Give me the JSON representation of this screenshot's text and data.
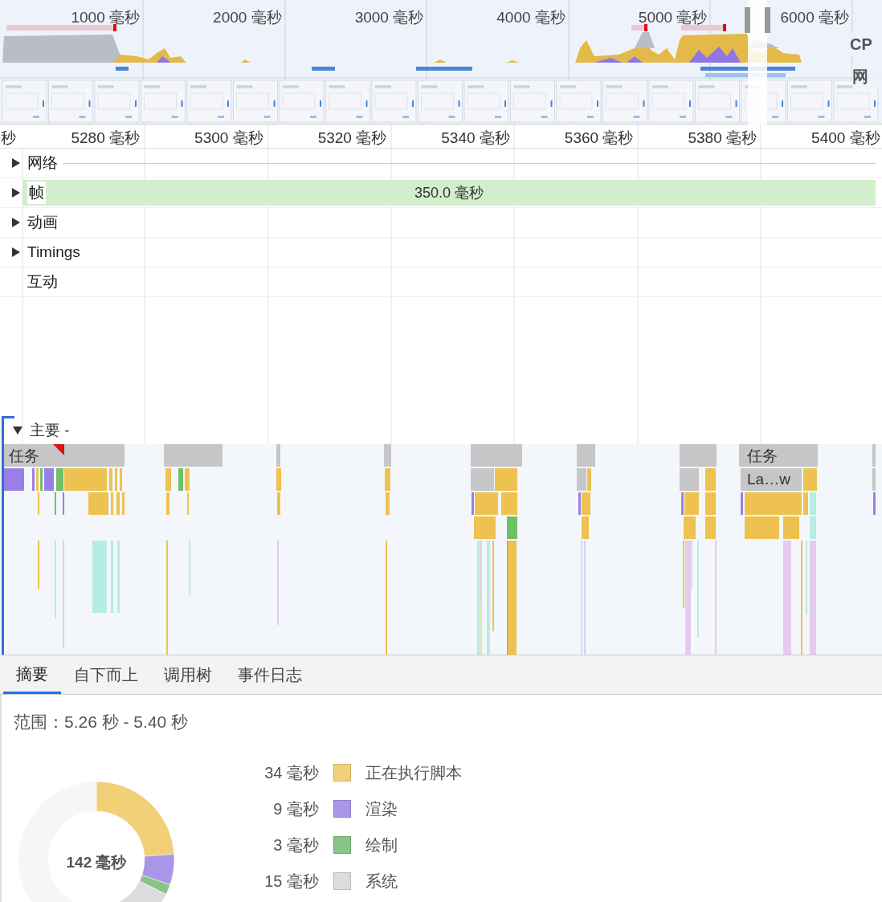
{
  "overview": {
    "ticks": [
      "1000 毫秒",
      "2000 毫秒",
      "3000 毫秒",
      "4000 毫秒",
      "5000 毫秒",
      "6000 毫秒"
    ],
    "cpu_label": "CP",
    "network_label": "网"
  },
  "ruler": {
    "ticks": [
      "秒",
      "5280 毫秒",
      "5300 毫秒",
      "5320 毫秒",
      "5340 毫秒",
      "5360 毫秒",
      "5380 毫秒",
      "5400 毫秒"
    ]
  },
  "tracks": [
    {
      "label": "网络",
      "kind": "toggle",
      "expanded": false
    },
    {
      "label": "帧",
      "kind": "toggle",
      "expanded": false,
      "band": "350.0 毫秒"
    },
    {
      "label": "动画",
      "kind": "toggle",
      "expanded": false
    },
    {
      "label": "Timings",
      "kind": "toggle",
      "expanded": false
    },
    {
      "label": "互动",
      "kind": "plain"
    }
  ],
  "main": {
    "label": "主要 -",
    "expanded": true,
    "task_labels": [
      "任务",
      "任务"
    ],
    "slice_label": "La…w"
  },
  "tabs": [
    {
      "label": "摘要",
      "selected": true
    },
    {
      "label": "自下而上",
      "selected": false
    },
    {
      "label": "调用树",
      "selected": false
    },
    {
      "label": "事件日志",
      "selected": false
    }
  ],
  "summary": {
    "range": "范围：5.26 秒 - 5.40 秒",
    "total": "142 毫秒",
    "legend": [
      {
        "value": "34 毫秒",
        "label": "正在执行脚本",
        "color": "#f1d078"
      },
      {
        "value": "9 毫秒",
        "label": "渲染",
        "color": "#a996e8"
      },
      {
        "value": "3 毫秒",
        "label": "绘制",
        "color": "#88c485"
      },
      {
        "value": "15 毫秒",
        "label": "系统",
        "color": "#dcdcdc"
      }
    ]
  }
}
